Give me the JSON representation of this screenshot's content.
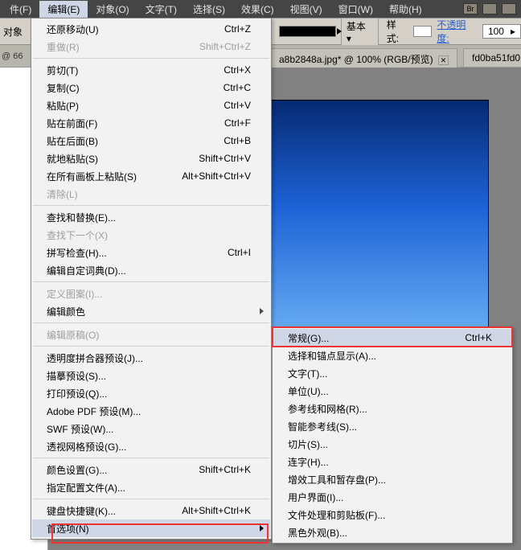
{
  "menubar": {
    "items": [
      "件(F)",
      "编辑(E)",
      "对象(O)",
      "文字(T)",
      "选择(S)",
      "效果(C)",
      "视图(V)",
      "窗口(W)",
      "帮助(H)"
    ],
    "open_index": 1,
    "extra": {
      "br": "Br"
    }
  },
  "options_row": {
    "left_label": "对象",
    "zoom": "@ 66",
    "mode": "基本",
    "style_lbl": "样式:",
    "opacity_lbl": "不透明度:",
    "opacity_val": "100"
  },
  "tabs": {
    "bg": "a8b2848a.jpg* @ 100% (RGB/预览)",
    "fg": "fd0ba51fd0",
    "close_glyph": "✕"
  },
  "menu1": [
    {
      "label": "还原移动(U)",
      "sc": "Ctrl+Z"
    },
    {
      "label": "重做(R)",
      "sc": "Shift+Ctrl+Z",
      "dis": true
    },
    {
      "sep": true
    },
    {
      "label": "剪切(T)",
      "sc": "Ctrl+X"
    },
    {
      "label": "复制(C)",
      "sc": "Ctrl+C"
    },
    {
      "label": "粘贴(P)",
      "sc": "Ctrl+V"
    },
    {
      "label": "贴在前面(F)",
      "sc": "Ctrl+F"
    },
    {
      "label": "贴在后面(B)",
      "sc": "Ctrl+B"
    },
    {
      "label": "就地粘贴(S)",
      "sc": "Shift+Ctrl+V"
    },
    {
      "label": "在所有画板上粘贴(S)",
      "sc": "Alt+Shift+Ctrl+V"
    },
    {
      "label": "清除(L)",
      "dis": true
    },
    {
      "sep": true
    },
    {
      "label": "查找和替换(E)..."
    },
    {
      "label": "查找下一个(X)",
      "dis": true
    },
    {
      "label": "拼写检查(H)...",
      "sc": "Ctrl+I"
    },
    {
      "label": "编辑自定词典(D)..."
    },
    {
      "sep": true
    },
    {
      "label": "定义图案(I)...",
      "dis": true
    },
    {
      "label": "编辑颜色",
      "sub": true
    },
    {
      "sep": true
    },
    {
      "label": "编辑原稿(O)",
      "dis": true
    },
    {
      "sep": true
    },
    {
      "label": "透明度拼合器预设(J)..."
    },
    {
      "label": "描摹预设(S)..."
    },
    {
      "label": "打印预设(Q)..."
    },
    {
      "label": "Adobe PDF 预设(M)..."
    },
    {
      "label": "SWF 预设(W)..."
    },
    {
      "label": "透视网格预设(G)..."
    },
    {
      "sep": true
    },
    {
      "label": "颜色设置(G)...",
      "sc": "Shift+Ctrl+K"
    },
    {
      "label": "指定配置文件(A)..."
    },
    {
      "sep": true
    },
    {
      "label": "键盘快捷键(K)...",
      "sc": "Alt+Shift+Ctrl+K"
    },
    {
      "label": "首选项(N)",
      "sub": true,
      "sel": true
    }
  ],
  "menu2": [
    {
      "label": "常规(G)...",
      "sc": "Ctrl+K",
      "hl": true
    },
    {
      "label": "选择和锚点显示(A)..."
    },
    {
      "label": "文字(T)..."
    },
    {
      "label": "单位(U)..."
    },
    {
      "label": "参考线和网格(R)..."
    },
    {
      "label": "智能参考线(S)..."
    },
    {
      "label": "切片(S)..."
    },
    {
      "label": "连字(H)..."
    },
    {
      "label": "增效工具和暂存盘(P)..."
    },
    {
      "label": "用户界面(I)..."
    },
    {
      "label": "文件处理和剪贴板(F)..."
    },
    {
      "label": "黑色外观(B)..."
    }
  ]
}
